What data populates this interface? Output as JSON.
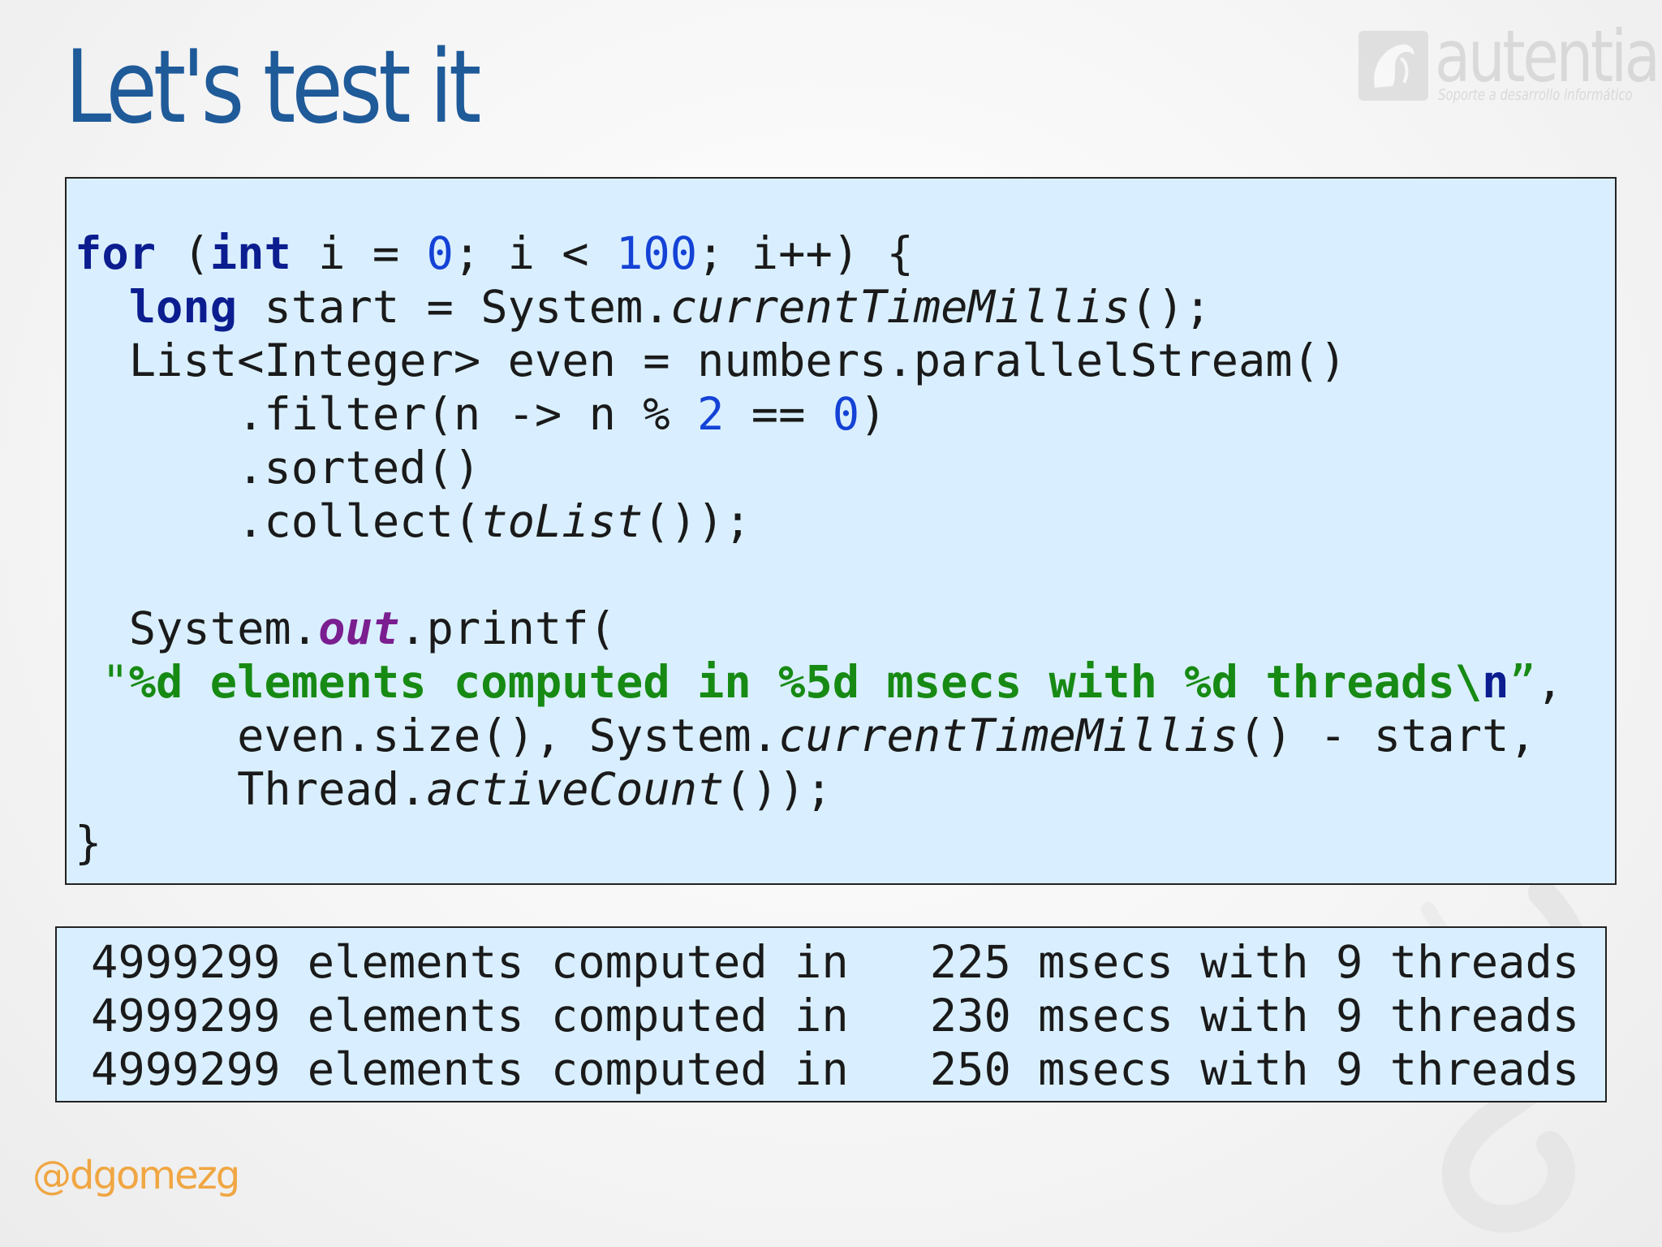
{
  "slide": {
    "title": "Let's test it",
    "handle": "@dgomezg",
    "logo": {
      "word": "autentia",
      "tagline": "Soporte a desarrollo informático",
      "icon": "autentia-logo-icon"
    }
  },
  "code_lines": [
    [
      {
        "t": "for",
        "c": "kw"
      },
      {
        "t": " ("
      },
      {
        "t": "int",
        "c": "kw"
      },
      {
        "t": " i = "
      },
      {
        "t": "0",
        "c": "num"
      },
      {
        "t": "; i < "
      },
      {
        "t": "100",
        "c": "num"
      },
      {
        "t": "; i++) {"
      }
    ],
    [
      {
        "t": "  "
      },
      {
        "t": "long",
        "c": "kw"
      },
      {
        "t": " start = System."
      },
      {
        "t": "currentTimeMillis",
        "c": "it"
      },
      {
        "t": "();"
      }
    ],
    [
      {
        "t": "  List<Integer> even = numbers.parallelStream()"
      }
    ],
    [
      {
        "t": "      .filter(n -> n % "
      },
      {
        "t": "2",
        "c": "num"
      },
      {
        "t": " == "
      },
      {
        "t": "0",
        "c": "num"
      },
      {
        "t": ")"
      }
    ],
    [
      {
        "t": "      .sorted()"
      }
    ],
    [
      {
        "t": "      .collect("
      },
      {
        "t": "toList",
        "c": "it"
      },
      {
        "t": "());"
      }
    ],
    [
      {
        "t": ""
      }
    ],
    [
      {
        "t": "  System."
      },
      {
        "t": "out",
        "c": "field"
      },
      {
        "t": ".printf("
      }
    ],
    [
      {
        "t": " \"",
        "c": "strq"
      },
      {
        "t": "%d elements computed in %5d msecs with %d threads\\",
        "c": "str"
      },
      {
        "t": "n",
        "c": "kw"
      },
      {
        "t": "”",
        "c": "strq"
      },
      {
        "t": ","
      }
    ],
    [
      {
        "t": "      even.size(), System."
      },
      {
        "t": "currentTimeMillis",
        "c": "it"
      },
      {
        "t": "() - start,"
      }
    ],
    [
      {
        "t": "      Thread."
      },
      {
        "t": "activeCount",
        "c": "it"
      },
      {
        "t": "());"
      }
    ],
    [
      {
        "t": "}"
      }
    ]
  ],
  "output_lines": [
    "4999299 elements computed in   225 msecs with 9 threads",
    "4999299 elements computed in   230 msecs with 9 threads",
    "4999299 elements computed in   250 msecs with 9 threads"
  ]
}
